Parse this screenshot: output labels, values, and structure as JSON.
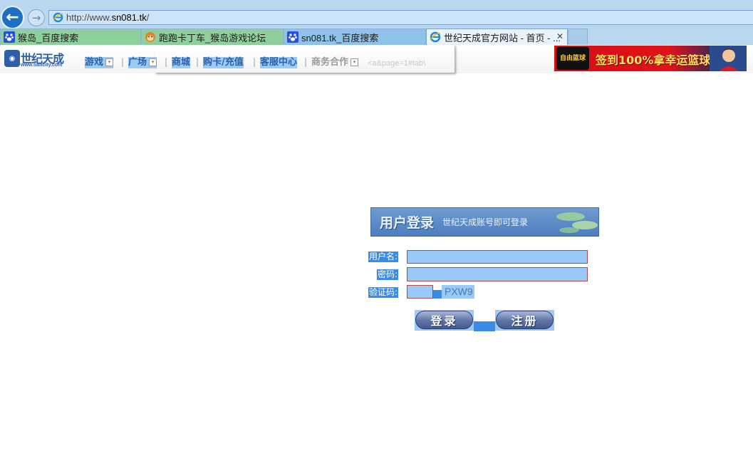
{
  "browser": {
    "address_url_prefix": "http://www.",
    "address_url_host": "sn081.tk",
    "address_url_suffix": "/",
    "tabs": [
      {
        "label": "猴岛_百度搜索",
        "icon": "baidu-paw-icon"
      },
      {
        "label": "跑跑卡丁车_猴岛游戏论坛",
        "icon": "monkey-face-icon"
      },
      {
        "label": "sn081.tk_百度搜索",
        "icon": "baidu-paw-icon"
      },
      {
        "label": "世纪天成官方网站 - 首页 - ...",
        "icon": "ie-logo-icon",
        "active": true
      }
    ],
    "close_glyph": "✕"
  },
  "site": {
    "logo_name": "世纪天成",
    "logo_domain": "www.tiancity.com",
    "nav": [
      {
        "label": "游戏",
        "has_dropdown": true
      },
      {
        "label": "广场",
        "has_dropdown": true
      },
      {
        "label": "商城",
        "has_dropdown": false
      },
      {
        "label": "购卡/充值",
        "has_dropdown": false
      },
      {
        "label": "客服中心",
        "has_dropdown": false
      },
      {
        "label": "商务合作",
        "has_dropdown": true
      }
    ],
    "nav_separator": "|",
    "dropdown_glyph": "▾",
    "faint_text": "<a&page=1#tab\\",
    "banner": {
      "logo_text": "自由篮球",
      "text": "签到100%拿幸运篮球"
    }
  },
  "login": {
    "title": "用户登录",
    "subtitle": "世纪天成账号即可登录",
    "username_label": "用户名:",
    "password_label": "密码:",
    "captcha_label": "验证码:",
    "captcha_code": "PXW9",
    "login_button": "登录",
    "register_button": "注册"
  },
  "colors": {
    "chrome_bg": "#b9d7ef",
    "highlight": "#3b8be6",
    "field_bg": "#9bc9f7",
    "nav_text": "#2b61a8"
  }
}
